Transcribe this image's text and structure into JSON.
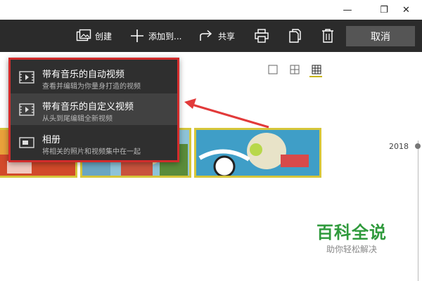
{
  "window": {
    "minimize_glyph": "—",
    "maximize_glyph": "❐",
    "close_glyph": "✕"
  },
  "toolbar": {
    "create_label": "创建",
    "add_to_label": "添加到...",
    "share_label": "共享",
    "cancel_label": "取消",
    "icons": [
      "create-icon",
      "add-icon",
      "share-icon",
      "print-icon",
      "copy-icon",
      "delete-icon"
    ]
  },
  "view_toggles": [
    "single-view-icon",
    "four-grid-view-icon",
    "nine-grid-view-icon"
  ],
  "dropdown": {
    "items": [
      {
        "title": "带有音乐的自动视频",
        "subtitle": "查看并编辑为你量身打造的视频",
        "icon": "auto-video-icon"
      },
      {
        "title": "带有音乐的自定义视频",
        "subtitle": "从头到尾编辑全新视频",
        "icon": "custom-video-icon"
      },
      {
        "title": "相册",
        "subtitle": "将相关的照片和视频集中在一起",
        "icon": "album-icon"
      }
    ]
  },
  "timeline": {
    "year": "2018"
  },
  "watermark": {
    "main": "百科全说",
    "sub": "助你轻松解决"
  },
  "colors": {
    "toolbar_bg": "#2b2b2b",
    "dropdown_bg": "#2f2f2f",
    "highlight_border": "#d22c2c",
    "thumb_border": "#d6c63a",
    "watermark_green": "#2f9a3c"
  }
}
